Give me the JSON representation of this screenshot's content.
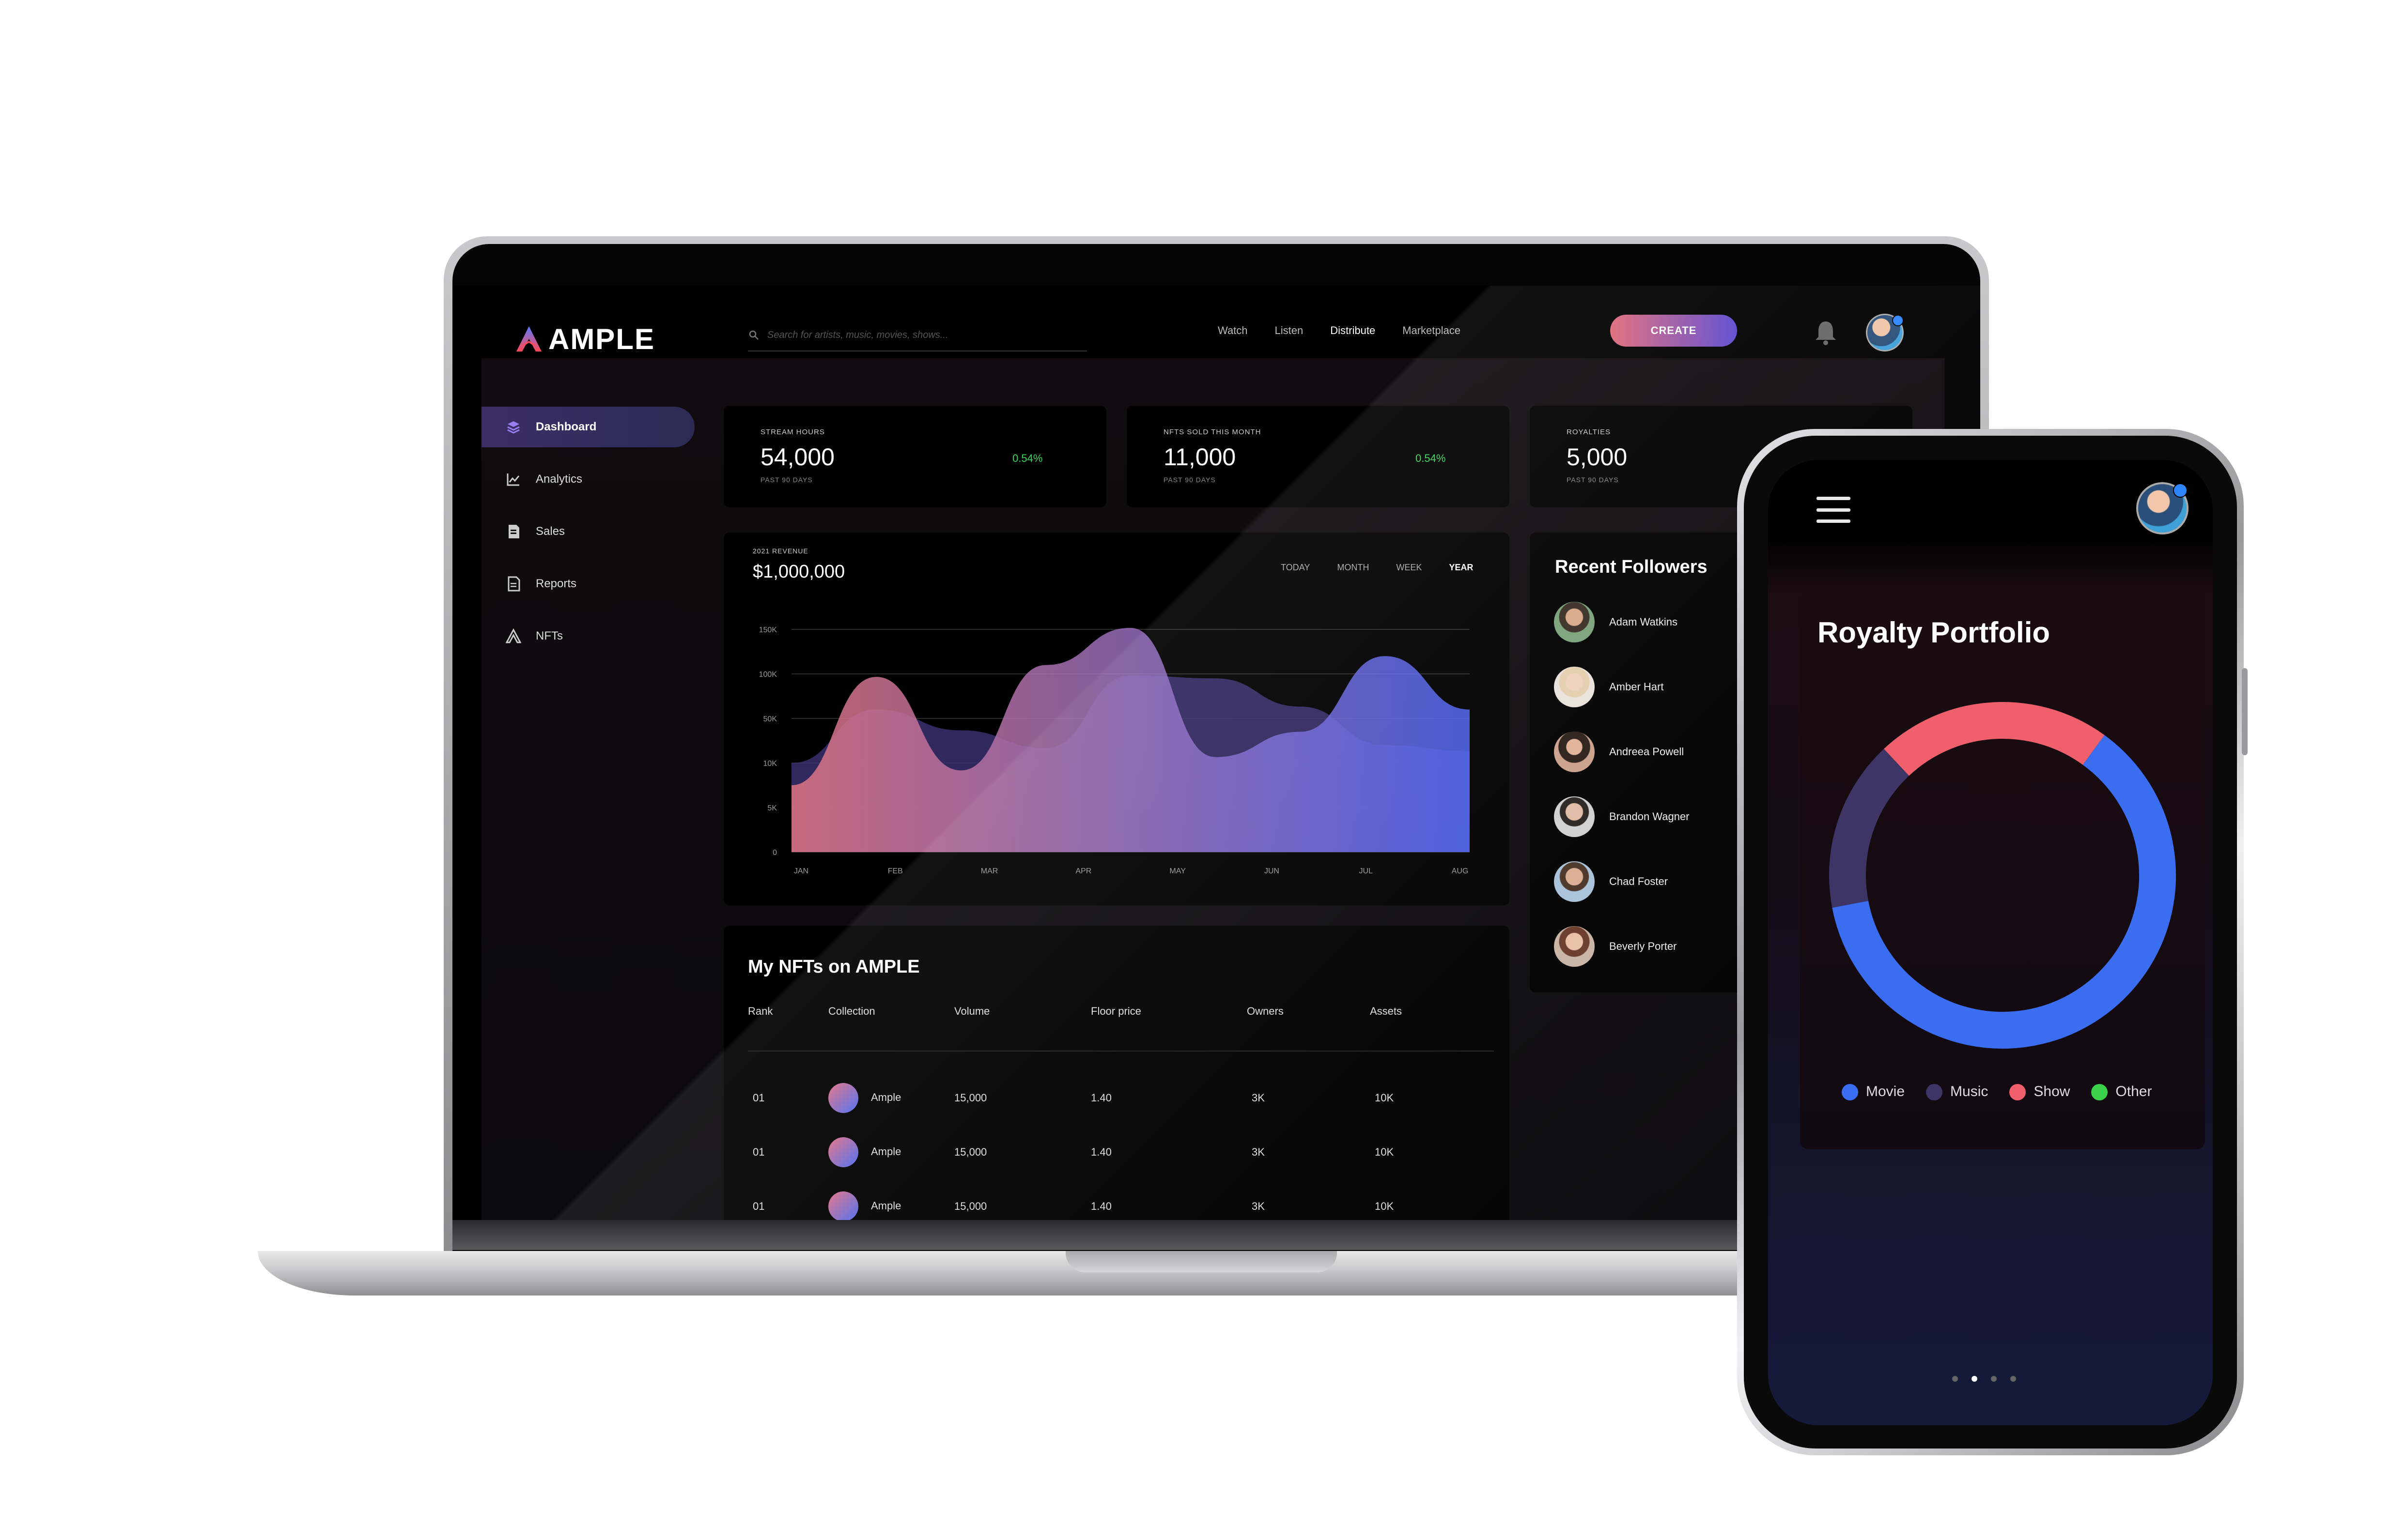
{
  "app": {
    "logo": "AMPLE",
    "search_placeholder": "Search for artists, music, movies, shows...",
    "nav": [
      "Watch",
      "Listen",
      "Distribute",
      "Marketplace"
    ],
    "active_nav": "Distribute",
    "create_label": "CREATE"
  },
  "sidebar": {
    "items": [
      {
        "label": "Dashboard",
        "icon": "layers-icon"
      },
      {
        "label": "Analytics",
        "icon": "chart-line-icon"
      },
      {
        "label": "Sales",
        "icon": "invoice-icon"
      },
      {
        "label": "Reports",
        "icon": "document-icon"
      },
      {
        "label": "NFTs",
        "icon": "ample-logo-icon"
      }
    ],
    "active": "Dashboard"
  },
  "stats": [
    {
      "label": "STREAM HOURS",
      "value": "54,000",
      "sub": "PAST 90 DAYS",
      "change": "0.54%"
    },
    {
      "label": "NFTS SOLD THIS MONTH",
      "value": "11,000",
      "sub": "PAST 90 DAYS",
      "change": "0.54%"
    },
    {
      "label": "ROYALTIES",
      "value": "5,000",
      "sub": "PAST 90 DAYS",
      "change": ""
    }
  ],
  "revenue": {
    "label": "2021 REVENUE",
    "value": "$1,000,000",
    "tabs": [
      "TODAY",
      "MONTH",
      "WEEK",
      "YEAR"
    ],
    "active_tab": "YEAR"
  },
  "chart_data": {
    "type": "area",
    "x": [
      "JAN",
      "FEB",
      "MAR",
      "APR",
      "MAY",
      "JUN",
      "JUL",
      "AUG"
    ],
    "y_ticks": [
      "150K",
      "100K",
      "50K",
      "10K",
      "5K",
      "0"
    ],
    "series": [
      {
        "values": [
          45,
          118,
          55,
          126,
          151,
          64,
          81,
          132,
          96
        ]
      },
      {
        "values": [
          60,
          96,
          82,
          70,
          119,
          117,
          98,
          72,
          68
        ]
      }
    ],
    "colors": [
      "#e07583",
      "#4b63f2",
      "#3a2f6e"
    ]
  },
  "followers": {
    "title": "Recent Followers",
    "items": [
      "Adam Watkins",
      "Amber Hart",
      "Andreea Powell",
      "Brandon Wagner",
      "Chad Foster",
      "Beverly Porter"
    ]
  },
  "nfts": {
    "title": "My NFTs on AMPLE",
    "columns": [
      "Rank",
      "Collection",
      "Volume",
      "Floor price",
      "Owners",
      "Assets"
    ],
    "rows": [
      {
        "rank": "01",
        "collection": "Ample",
        "volume": "15,000",
        "floor": "1.40",
        "owners": "3K",
        "assets": "10K"
      },
      {
        "rank": "01",
        "collection": "Ample",
        "volume": "15,000",
        "floor": "1.40",
        "owners": "3K",
        "assets": "10K"
      },
      {
        "rank": "01",
        "collection": "Ample",
        "volume": "15,000",
        "floor": "1.40",
        "owners": "3K",
        "assets": "10K"
      }
    ]
  },
  "phone": {
    "title": "Royalty Portfolio",
    "donut": [
      {
        "name": "Movie",
        "value": 62,
        "color": "#3a6df0"
      },
      {
        "name": "Music",
        "value": 16,
        "color": "#3d3566"
      },
      {
        "name": "Show",
        "value": 22,
        "color": "#f0606c"
      },
      {
        "name": "Other",
        "value": 0,
        "color": "#3bd14a"
      }
    ],
    "pages": 4,
    "active_page": 1
  }
}
